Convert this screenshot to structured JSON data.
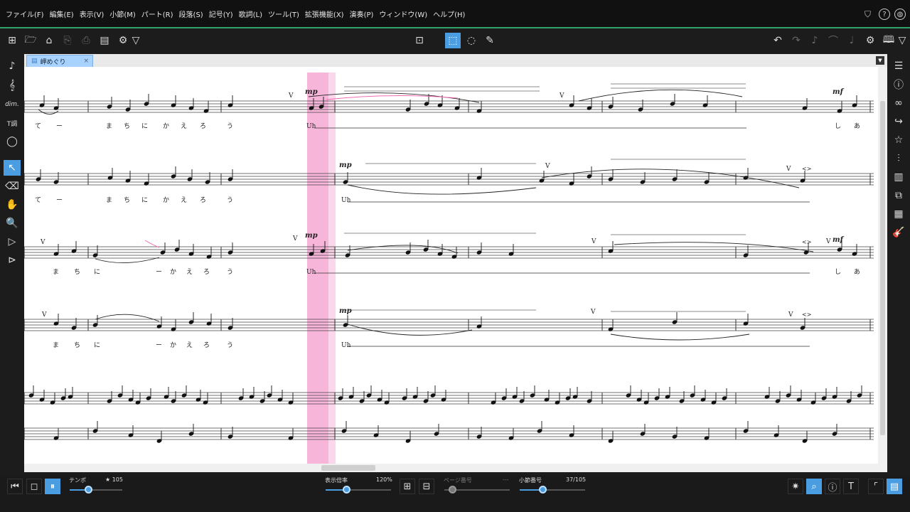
{
  "menu": [
    "ファイル(F)",
    "編集(E)",
    "表示(V)",
    "小節(M)",
    "パート(R)",
    "段落(S)",
    "記号(Y)",
    "歌詞(L)",
    "ツール(T)",
    "拡張機能(X)",
    "演奏(P)",
    "ウィンドウ(W)",
    "ヘルプ(H)"
  ],
  "tab": {
    "title": "岬めぐり",
    "close": "×"
  },
  "status": {
    "tempo_label": "テンポ",
    "tempo_value": "★ 105",
    "tempo_fraction": 0.35,
    "zoom_label": "表示倍率",
    "zoom_value": "120%",
    "zoom_fraction": 0.32,
    "page_label": "ページ番号",
    "page_value": "---",
    "measure_label": "小節番号",
    "measure_value": "37/105",
    "measure_fraction": 0.35
  },
  "score": {
    "dynamics": {
      "mp": "mp",
      "mf": "mf",
      "breath": "V",
      "fermata_mark": "<>"
    },
    "lyrics": {
      "s1": [
        "て",
        "ー",
        "ま",
        "ち",
        "に",
        "か",
        "え",
        "ろ",
        "う",
        "Uh",
        "し",
        "あ"
      ],
      "s2": [
        "て",
        "ー",
        "ま",
        "ち",
        "に",
        "か",
        "え",
        "ろ",
        "う",
        "Uh"
      ],
      "s3": [
        "ま",
        "ち",
        "に",
        "ー",
        "か",
        "え",
        "ろ",
        "う",
        "Uh",
        "し",
        "あ"
      ],
      "s4": [
        "ま",
        "ち",
        "に",
        "ー",
        "か",
        "え",
        "ろ",
        "う",
        "Uh"
      ]
    }
  },
  "colors": {
    "accent": "#4a9de0",
    "highlight": "#f06cb4",
    "menu_line": "#2fa36b"
  }
}
